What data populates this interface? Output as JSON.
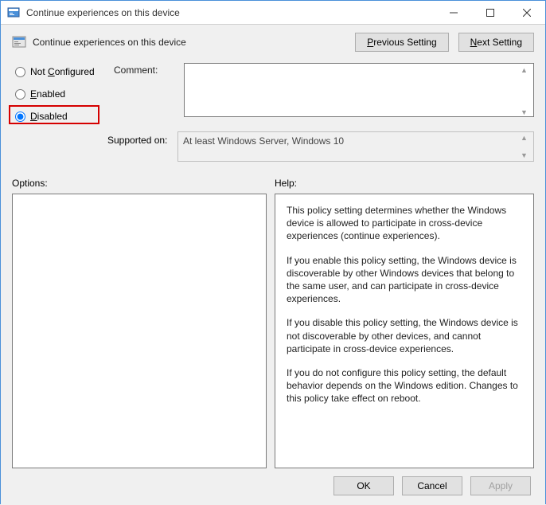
{
  "titlebar": {
    "title": "Continue experiences on this device"
  },
  "header": {
    "title": "Continue experiences on this device",
    "previous_setting": "Previous Setting",
    "next_setting": "Next Setting"
  },
  "radios": {
    "not_configured": "Not Configured",
    "enabled": "Enabled",
    "disabled": "Disabled",
    "selected": "disabled"
  },
  "labels": {
    "comment": "Comment:",
    "supported_on": "Supported on:",
    "options": "Options:",
    "help": "Help:"
  },
  "fields": {
    "comment": "",
    "supported_on": "At least Windows Server, Windows 10"
  },
  "help": {
    "p1": "This policy setting determines whether the Windows device is allowed to participate in cross-device experiences (continue experiences).",
    "p2": "If you enable this policy setting, the Windows device is discoverable by other Windows devices that belong to the same user, and can participate in cross-device experiences.",
    "p3": "If you disable this policy setting, the Windows device is not discoverable by other devices, and cannot participate in cross-device experiences.",
    "p4": "If you do not configure this policy setting, the default behavior depends on the Windows edition. Changes to this policy take effect on reboot."
  },
  "footer": {
    "ok": "OK",
    "cancel": "Cancel",
    "apply": "Apply"
  }
}
